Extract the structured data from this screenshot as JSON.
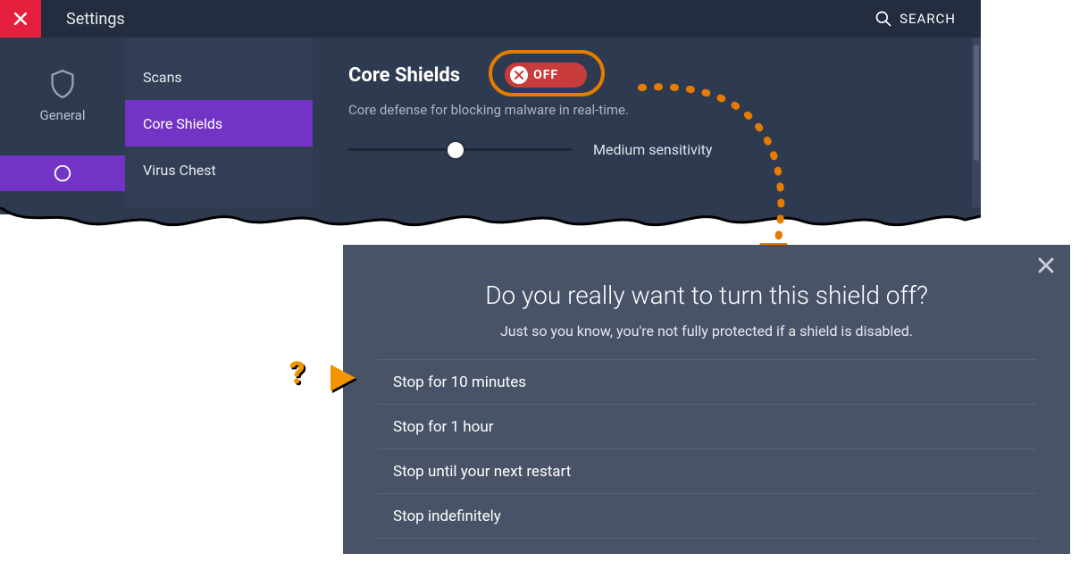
{
  "title_bar": {
    "title": "Settings",
    "search_label": "SEARCH"
  },
  "left_sidebar": {
    "general_label": "General"
  },
  "sub_sidebar": {
    "items": [
      {
        "label": "Scans"
      },
      {
        "label": "Core Shields"
      },
      {
        "label": "Virus Chest"
      }
    ]
  },
  "content": {
    "section_title": "Core Shields",
    "toggle_label": "OFF",
    "description": "Core defense for blocking malware in real-time.",
    "slider_label": "Medium sensitivity"
  },
  "modal": {
    "title": "Do you really want to turn this shield off?",
    "subtitle": "Just so you know, you're not fully protected if a shield is disabled.",
    "options": [
      {
        "label": "Stop for 10 minutes"
      },
      {
        "label": "Stop for 1 hour"
      },
      {
        "label": "Stop until your next restart"
      },
      {
        "label": "Stop indefinitely"
      }
    ]
  },
  "callout": {
    "question_mark": "?"
  }
}
